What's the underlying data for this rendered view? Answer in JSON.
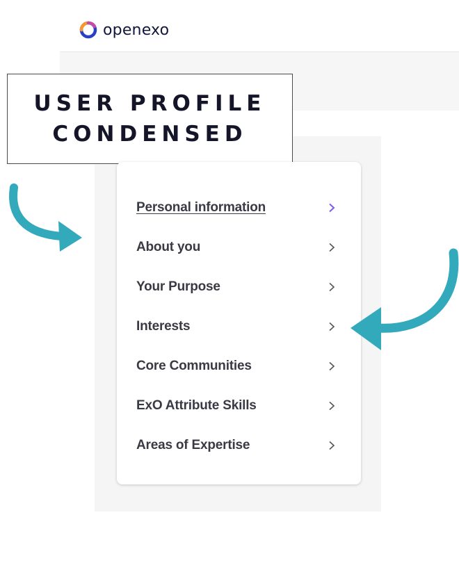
{
  "header": {
    "brand": "openexo"
  },
  "title_box": {
    "line1": "USER PROFILE",
    "line2": "CONDENSED"
  },
  "menu": {
    "items": [
      {
        "label": "Personal information",
        "active": true
      },
      {
        "label": "About you",
        "active": false
      },
      {
        "label": "Your Purpose",
        "active": false
      },
      {
        "label": "Interests",
        "active": false
      },
      {
        "label": "Core Communities",
        "active": false
      },
      {
        "label": "ExO Attribute Skills",
        "active": false
      },
      {
        "label": "Areas of Expertise",
        "active": false
      }
    ]
  },
  "colors": {
    "accent": "#7b5cf0",
    "chevron": "#555555",
    "arrow": "#33a9bc",
    "logo_orange": "#f39a2a",
    "logo_blue": "#2a3ec9",
    "text": "#3a3a45"
  },
  "icons": {
    "chevron": "chevron-right-icon",
    "logo": "openexo-logo-icon",
    "annotation_arrow": "curved-arrow-icon"
  }
}
